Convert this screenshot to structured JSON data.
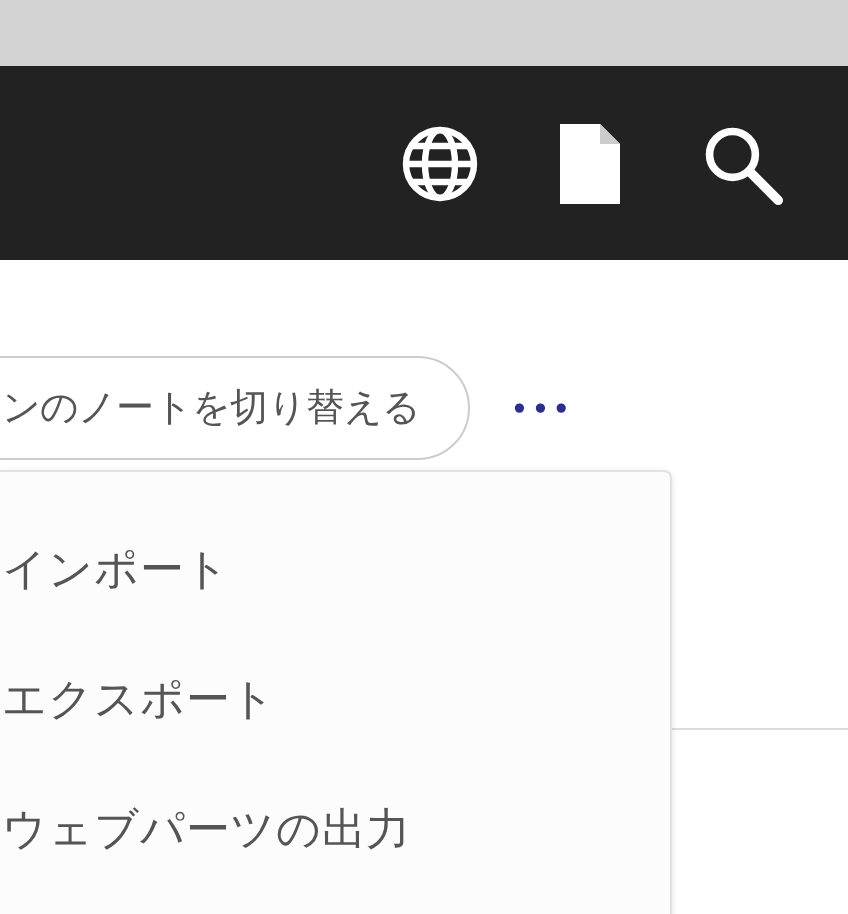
{
  "toolbar": {
    "switch_button": "ンのノートを切り替える",
    "more_button": "•••"
  },
  "menu": {
    "items": [
      {
        "label": "インポート"
      },
      {
        "label": "エクスポート"
      },
      {
        "label": "ウェブパーツの出力"
      }
    ]
  }
}
